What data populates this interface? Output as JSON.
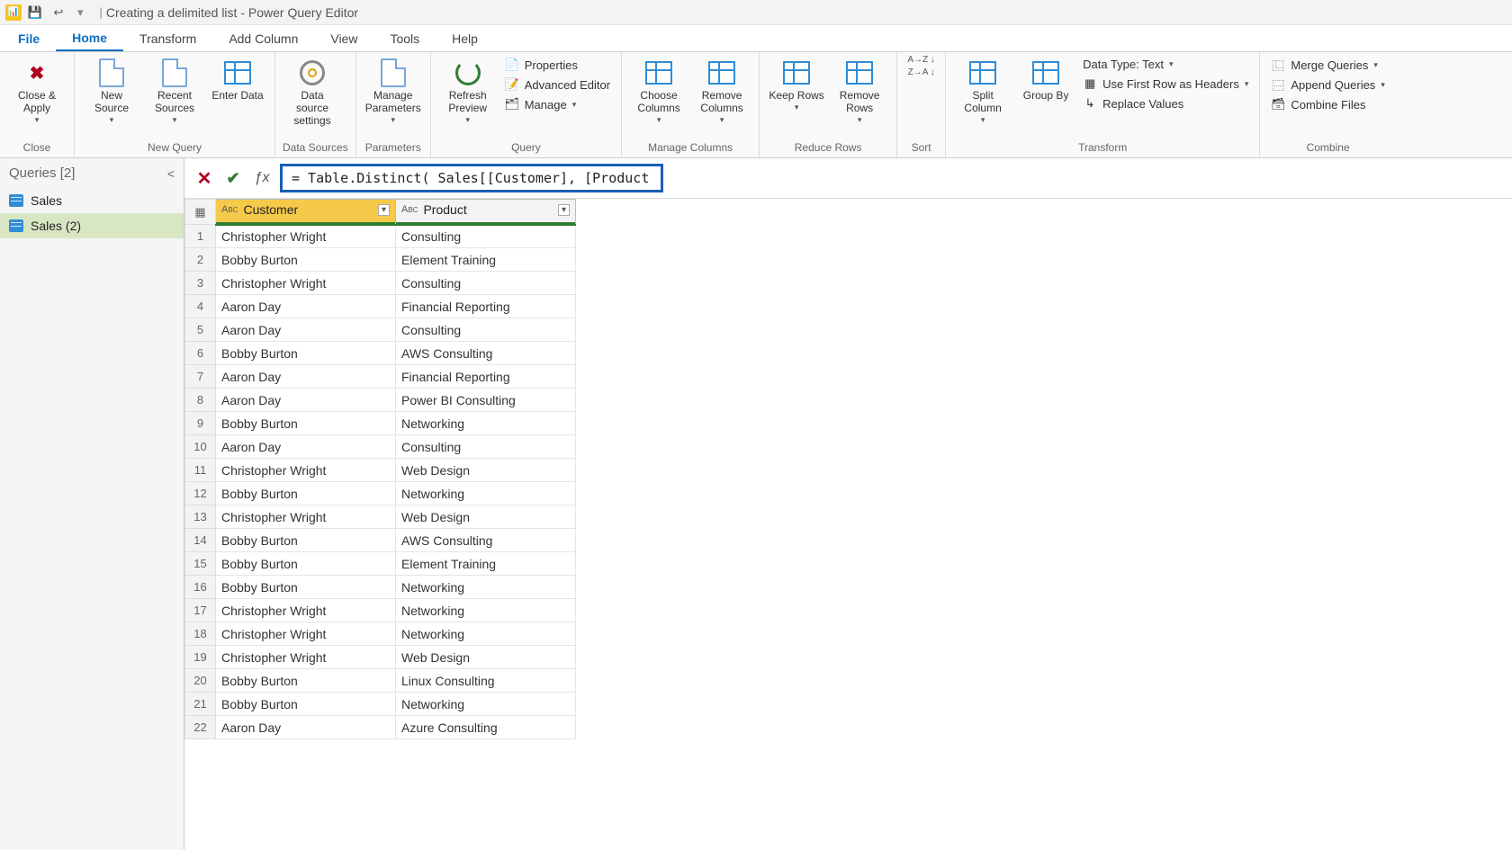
{
  "titlebar": {
    "app_name": "Power Query Editor",
    "doc_title": "Creating a delimited list",
    "full_title": "Creating a delimited list - Power Query Editor"
  },
  "menutabs": {
    "file": "File",
    "home": "Home",
    "transform": "Transform",
    "add_column": "Add Column",
    "view": "View",
    "tools": "Tools",
    "help": "Help"
  },
  "ribbon": {
    "close": {
      "close_apply": "Close &\nApply",
      "group": "Close"
    },
    "new_query": {
      "new_source": "New\nSource",
      "recent_sources": "Recent\nSources",
      "enter_data": "Enter\nData",
      "group": "New Query"
    },
    "data_sources": {
      "settings": "Data source\nsettings",
      "group": "Data Sources"
    },
    "parameters": {
      "manage": "Manage\nParameters",
      "group": "Parameters"
    },
    "query": {
      "refresh": "Refresh\nPreview",
      "properties": "Properties",
      "advanced_editor": "Advanced Editor",
      "manage": "Manage",
      "group": "Query"
    },
    "manage_columns": {
      "choose": "Choose\nColumns",
      "remove": "Remove\nColumns",
      "group": "Manage Columns"
    },
    "reduce_rows": {
      "keep": "Keep\nRows",
      "remove": "Remove\nRows",
      "group": "Reduce Rows"
    },
    "sort": {
      "group": "Sort"
    },
    "transform": {
      "split": "Split\nColumn",
      "group_by": "Group\nBy",
      "data_type": "Data Type: Text",
      "first_row": "Use First Row as Headers",
      "replace": "Replace Values",
      "group": "Transform"
    },
    "combine": {
      "merge": "Merge Queries",
      "append": "Append Queries",
      "combine_files": "Combine Files",
      "group": "Combine"
    }
  },
  "sidebar": {
    "header": "Queries [2]",
    "items": [
      {
        "label": "Sales",
        "selected": false
      },
      {
        "label": "Sales (2)",
        "selected": true
      }
    ]
  },
  "formula": "= Table.Distinct( Sales[[Customer], [Product]] )",
  "columns": [
    {
      "name": "Customer",
      "type": "ABC",
      "selected": true
    },
    {
      "name": "Product",
      "type": "ABC",
      "selected": false
    }
  ],
  "rows": [
    {
      "n": 1,
      "customer": "Christopher Wright",
      "product": "Consulting"
    },
    {
      "n": 2,
      "customer": "Bobby Burton",
      "product": "Element Training"
    },
    {
      "n": 3,
      "customer": "Christopher Wright",
      "product": "Consulting"
    },
    {
      "n": 4,
      "customer": "Aaron Day",
      "product": "Financial Reporting"
    },
    {
      "n": 5,
      "customer": "Aaron Day",
      "product": "Consulting"
    },
    {
      "n": 6,
      "customer": "Bobby Burton",
      "product": "AWS Consulting"
    },
    {
      "n": 7,
      "customer": "Aaron Day",
      "product": "Financial Reporting"
    },
    {
      "n": 8,
      "customer": "Aaron Day",
      "product": "Power BI Consulting"
    },
    {
      "n": 9,
      "customer": "Bobby Burton",
      "product": "Networking"
    },
    {
      "n": 10,
      "customer": "Aaron Day",
      "product": "Consulting"
    },
    {
      "n": 11,
      "customer": "Christopher Wright",
      "product": "Web Design"
    },
    {
      "n": 12,
      "customer": "Bobby Burton",
      "product": "Networking"
    },
    {
      "n": 13,
      "customer": "Christopher Wright",
      "product": "Web Design"
    },
    {
      "n": 14,
      "customer": "Bobby Burton",
      "product": "AWS Consulting"
    },
    {
      "n": 15,
      "customer": "Bobby Burton",
      "product": "Element Training"
    },
    {
      "n": 16,
      "customer": "Bobby Burton",
      "product": "Networking"
    },
    {
      "n": 17,
      "customer": "Christopher Wright",
      "product": "Networking"
    },
    {
      "n": 18,
      "customer": "Christopher Wright",
      "product": "Networking"
    },
    {
      "n": 19,
      "customer": "Christopher Wright",
      "product": "Web Design"
    },
    {
      "n": 20,
      "customer": "Bobby Burton",
      "product": "Linux Consulting"
    },
    {
      "n": 21,
      "customer": "Bobby Burton",
      "product": "Networking"
    },
    {
      "n": 22,
      "customer": "Aaron Day",
      "product": "Azure Consulting"
    }
  ]
}
